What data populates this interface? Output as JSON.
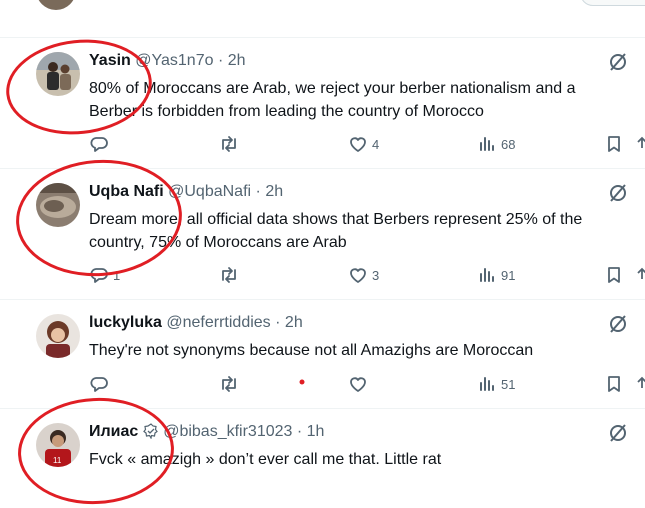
{
  "tweets": [
    {
      "name": "Yasin",
      "handle": "@Yas1n7o",
      "sep": "·",
      "time": "2h",
      "text_lines": [
        "80% of Moroccans are Arab, we reject your berber nationalism and a",
        "Berber is forbidden from leading the country of Morocco"
      ],
      "likes": "4",
      "views": "68"
    },
    {
      "name": "Uqba Nafi",
      "handle": "@UqbaNafi",
      "sep": "·",
      "time": "2h",
      "text_lines": [
        "Dream more, all official data shows that Berbers represent 25% of the",
        "country, 75% of Moroccans are Arab"
      ],
      "replies": "1",
      "likes": "3",
      "views": "91"
    },
    {
      "name": "luckyluka",
      "handle": "@neferrtiddies",
      "sep": "·",
      "time": "2h",
      "text_lines": [
        "They're not synonyms because not all Amazighs are Moroccan"
      ],
      "views": "51"
    },
    {
      "name": "Илиас",
      "handle": "@bibas_kfir31023",
      "sep": "·",
      "time": "1h",
      "text_lines": [
        "Fvck « amazigh » don’t ever call me that. Little rat"
      ]
    }
  ],
  "colors": {
    "annotation_circle": "#e01e24",
    "text_primary": "#0f1419",
    "text_secondary": "#536471",
    "divider": "#eff3f4"
  },
  "icons": [
    "reply-icon",
    "retweet-icon",
    "like-icon",
    "views-icon",
    "bookmark-icon",
    "share-icon",
    "grok-icon",
    "verified-badge-icon"
  ]
}
